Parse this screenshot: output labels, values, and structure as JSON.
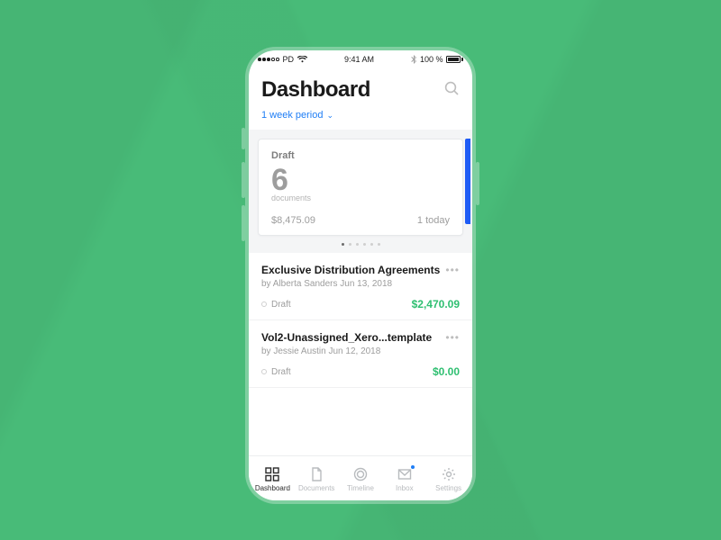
{
  "status": {
    "carrier": "PD",
    "time": "9:41 AM",
    "battery_pct": "100 %"
  },
  "header": {
    "title": "Dashboard"
  },
  "period": {
    "label": "1 week period"
  },
  "summary_card": {
    "status_label": "Draft",
    "count": "6",
    "count_label": "documents",
    "amount": "$8,475.09",
    "today_label": "1 today"
  },
  "documents": [
    {
      "title": "Exclusive Distribution Agreements",
      "byline": "by Alberta Sanders Jun 13, 2018",
      "status": "Draft",
      "amount": "$2,470.09"
    },
    {
      "title": "Vol2-Unassigned_Xero...template",
      "byline": "by Jessie Austin Jun 12, 2018",
      "status": "Draft",
      "amount": "$0.00"
    }
  ],
  "tabs": {
    "dashboard": "Dashboard",
    "documents": "Documents",
    "timeline": "Timeline",
    "inbox": "Inbox",
    "settings": "Settings"
  }
}
